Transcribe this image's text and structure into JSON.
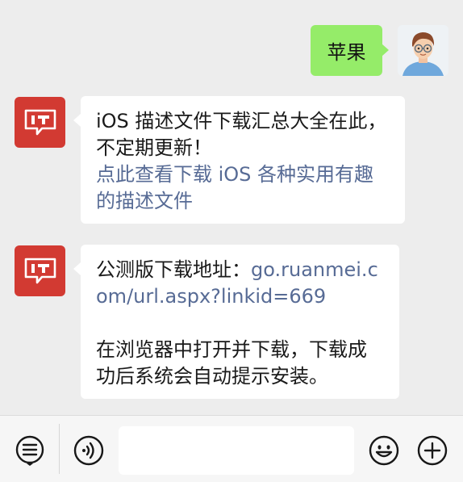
{
  "messages": {
    "outgoing": {
      "text": "苹果"
    },
    "incoming": [
      {
        "line_1": "iOS 描述文件下载汇总大全在此，不定期更新！",
        "link": "点此查看下载 iOS 各种实用有趣的描述文件"
      },
      {
        "label": "公测版下载地址：",
        "link": "go.ruanmei.com/url.aspx?linkid=669",
        "line_2": "在浏览器中打开并下载，下载成功后系统会自动提示安装。"
      }
    ],
    "sender_logo_text": "IT"
  },
  "colors": {
    "outgoing_bubble": "#95ec69",
    "incoming_bubble": "#ffffff",
    "link": "#576b95",
    "logo_red": "#d23a32",
    "background": "#ededed"
  },
  "input_bar": {
    "icons": [
      "menu-list-icon",
      "voice-icon",
      "emoji-icon",
      "plus-icon"
    ],
    "text_value": ""
  }
}
